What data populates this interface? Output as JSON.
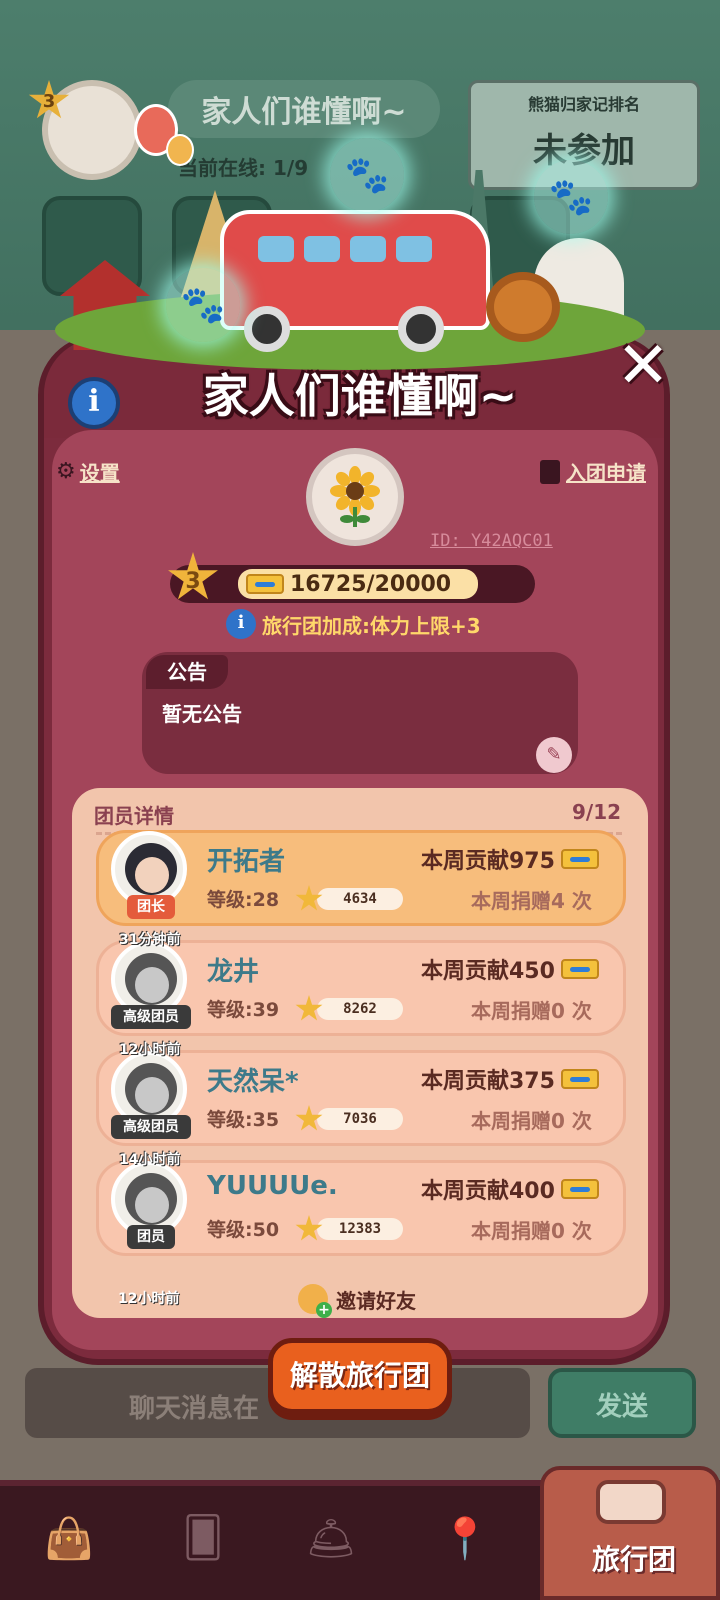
{
  "background": {
    "club_level": "3",
    "club_title": "家人们谁懂啊~",
    "online_label": "当前在线:",
    "online_value": "1/9",
    "ranking": {
      "title": "熊猫归家记排名",
      "value": "未参加"
    },
    "chat_placeholder": "聊天消息在",
    "send_label": "发送"
  },
  "dialog": {
    "title": "家人们谁懂啊~",
    "info_icon": "i",
    "close_icon": "✕",
    "settings_label": "设置",
    "apply_label": "入团申请",
    "club_id": "ID: Y42AQC01",
    "level": "3",
    "exp_text": "16725/20000",
    "exp_progress": 0.836,
    "bonus_text": "旅行团加成:体力上限+3",
    "notice": {
      "tab": "公告",
      "text": "暂无公告"
    },
    "members_title": "团员详情",
    "members_count": "9/12",
    "members": [
      {
        "name": "开拓者",
        "role": "团长",
        "ago": "",
        "level": "等级:28",
        "stars": "4634",
        "contribution": "本周贡献975",
        "donation": "本周捐赠4 次"
      },
      {
        "name": "龙井",
        "role": "高级团员",
        "ago": "31分钟前",
        "level": "等级:39",
        "stars": "8262",
        "contribution": "本周贡献450",
        "donation": "本周捐赠0 次"
      },
      {
        "name": "天然呆*",
        "role": "高级团员",
        "ago": "12小时前",
        "level": "等级:35",
        "stars": "7036",
        "contribution": "本周贡献375",
        "donation": "本周捐赠0 次"
      },
      {
        "name": "YUUUUe.",
        "role": "团员",
        "ago": "14小时前",
        "level": "等级:50",
        "stars": "12383",
        "contribution": "本周贡献400",
        "donation": "本周捐赠0 次"
      }
    ],
    "next_ago": "12小时前",
    "invite_label": "邀请好友",
    "disband_label": "解散旅行团"
  },
  "nav": {
    "items": [
      "shop-icon",
      "cards-icon",
      "bell-icon",
      "map-icon"
    ],
    "active_label": "旅行团"
  },
  "colors": {
    "panel": "#7c2b3d",
    "accent": "#e9601e",
    "bg": "#3f6f5f"
  }
}
